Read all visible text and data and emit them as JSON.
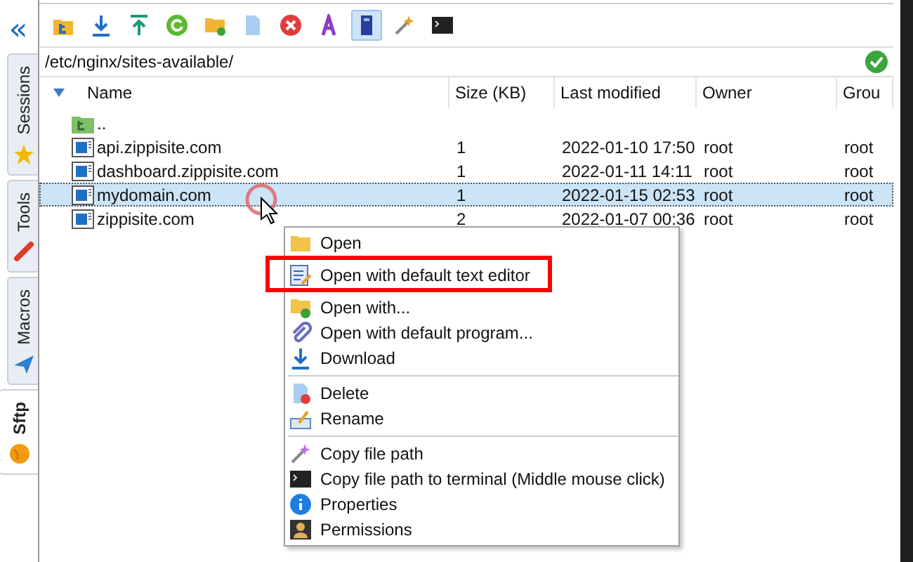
{
  "sidebar": {
    "collapse": "«",
    "tabs": [
      {
        "label": "Sessions",
        "selected": false
      },
      {
        "label": "Tools",
        "selected": false
      },
      {
        "label": "Macros",
        "selected": false
      },
      {
        "label": "Sftp",
        "selected": true
      }
    ]
  },
  "toolbar": [
    {
      "selected": false
    },
    {
      "selected": false
    },
    {
      "selected": false
    },
    {
      "selected": false
    },
    {
      "selected": false
    },
    {
      "selected": false
    },
    {
      "selected": false
    },
    {
      "selected": false
    },
    {
      "selected": true
    },
    {
      "selected": false
    },
    {
      "selected": false
    }
  ],
  "path": "/etc/nginx/sites-available/",
  "table": {
    "columns": [
      "Name",
      "Size (KB)",
      "Last modified",
      "Owner",
      "Grou"
    ],
    "rows": [
      {
        "kind": "parent",
        "name": "..",
        "selected": false
      },
      {
        "kind": "file",
        "name": "api.zippisite.com",
        "size": "1",
        "modified": "2022-01-10 17:50",
        "owner": "root",
        "group": "root",
        "selected": false
      },
      {
        "kind": "file",
        "name": "dashboard.zippisite.com",
        "size": "1",
        "modified": "2022-01-11 14:11",
        "owner": "root",
        "group": "root",
        "selected": false
      },
      {
        "kind": "file",
        "name": "mydomain.com",
        "size": "1",
        "modified": "2022-01-15 02:53",
        "owner": "root",
        "group": "root",
        "selected": true
      },
      {
        "kind": "file",
        "name": "zippisite.com",
        "size": "2",
        "modified": "2022-01-07 00:36",
        "owner": "root",
        "group": "root",
        "selected": false
      }
    ]
  },
  "context_menu": [
    {
      "kind": "item",
      "label": "Open",
      "highlighted": false
    },
    {
      "kind": "item",
      "label": "Open with default text editor",
      "highlighted": true
    },
    {
      "kind": "item",
      "label": "Open with...",
      "highlighted": false
    },
    {
      "kind": "item",
      "label": "Open with default program...",
      "highlighted": false
    },
    {
      "kind": "item",
      "label": "Download",
      "highlighted": false
    },
    {
      "kind": "separator"
    },
    {
      "kind": "item",
      "label": "Delete",
      "highlighted": false
    },
    {
      "kind": "item",
      "label": "Rename",
      "highlighted": false
    },
    {
      "kind": "separator"
    },
    {
      "kind": "item",
      "label": "Copy file path",
      "highlighted": false
    },
    {
      "kind": "item",
      "label": "Copy file path to terminal (Middle mouse click)",
      "highlighted": false
    },
    {
      "kind": "item",
      "label": "Properties",
      "highlighted": false
    },
    {
      "kind": "item",
      "label": "Permissions",
      "highlighted": false
    }
  ]
}
